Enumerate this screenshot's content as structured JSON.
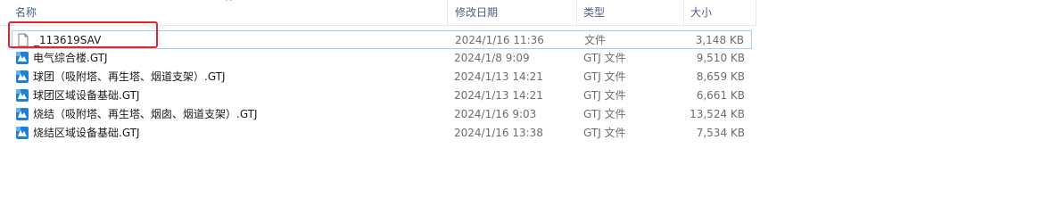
{
  "columns": {
    "name": "名称",
    "date_modified": "修改日期",
    "type": "类型",
    "size": "大小"
  },
  "sort_indicator": "^",
  "files": [
    {
      "name": "_113619SAV",
      "date": "2024/1/16 11:36",
      "type": "文件",
      "size": "3,148 KB",
      "icon": "blank-file-icon"
    },
    {
      "name": "电气综合楼.GTJ",
      "date": "2024/1/8 9:09",
      "type": "GTJ 文件",
      "size": "9,510 KB",
      "icon": "gtj-file-icon"
    },
    {
      "name": "球团（吸附塔、再生塔、烟道支架）.GTJ",
      "date": "2024/1/13 14:21",
      "type": "GTJ 文件",
      "size": "8,659 KB",
      "icon": "gtj-file-icon"
    },
    {
      "name": "球团区域设备基础.GTJ",
      "date": "2024/1/13 14:21",
      "type": "GTJ 文件",
      "size": "6,661 KB",
      "icon": "gtj-file-icon"
    },
    {
      "name": "烧结（吸附塔、再生塔、烟囱、烟道支架）.GTJ",
      "date": "2024/1/16 9:03",
      "type": "GTJ 文件",
      "size": "13,524 KB",
      "icon": "gtj-file-icon"
    },
    {
      "name": "烧结区域设备基础.GTJ",
      "date": "2024/1/16 13:38",
      "type": "GTJ 文件",
      "size": "7,534 KB",
      "icon": "gtj-file-icon"
    }
  ],
  "colors": {
    "header_text": "#4d6082",
    "highlight_box": "#e8262a",
    "row_outline": "#99d1ff",
    "gtj_icon": "#1e7fd6"
  }
}
